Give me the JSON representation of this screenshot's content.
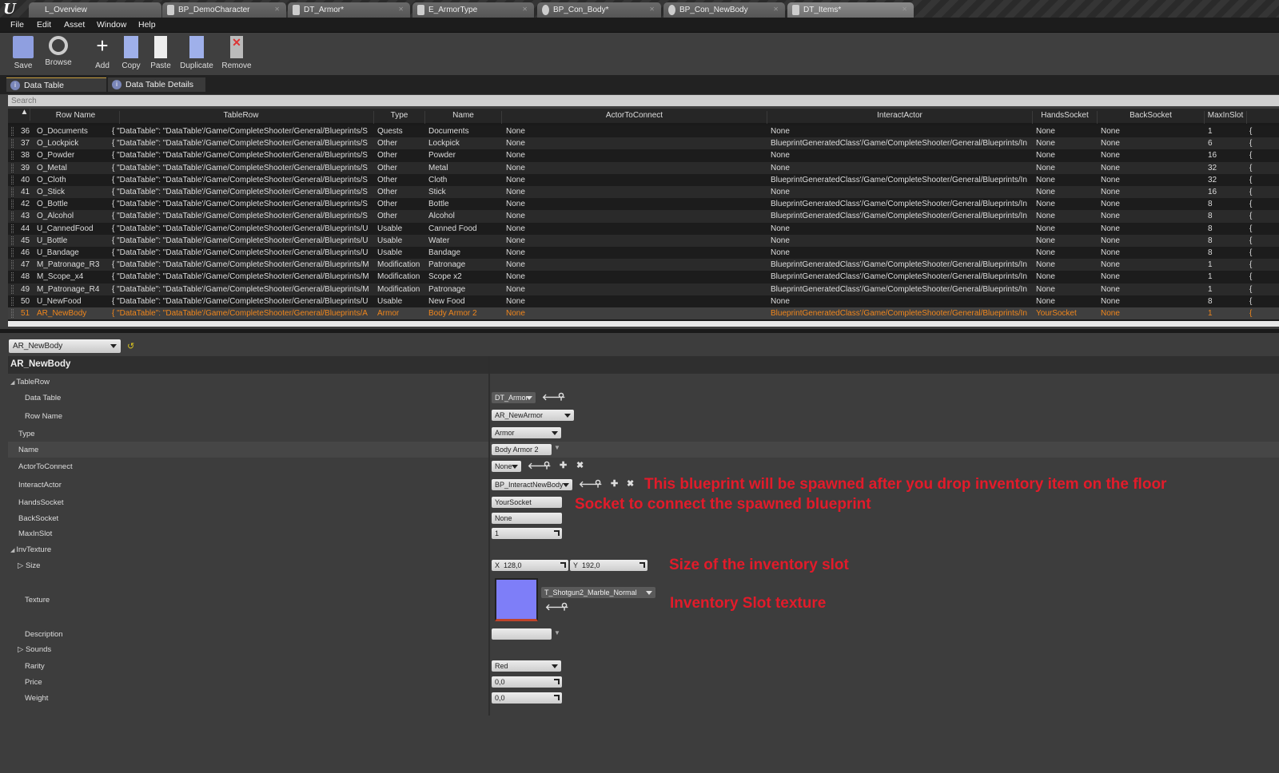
{
  "tabs": [
    {
      "label": "L_Overview",
      "active": false
    },
    {
      "label": "BP_DemoCharacter",
      "active": false
    },
    {
      "label": "DT_Armor*",
      "active": false
    },
    {
      "label": "E_ArmorType",
      "active": false
    },
    {
      "label": "BP_Con_Body*",
      "active": false
    },
    {
      "label": "BP_Con_NewBody",
      "active": false
    },
    {
      "label": "DT_Items*",
      "active": true
    }
  ],
  "menu": [
    "File",
    "Edit",
    "Asset",
    "Window",
    "Help"
  ],
  "toolbar": {
    "save": "Save",
    "browse": "Browse",
    "add": "Add",
    "copy": "Copy",
    "paste": "Paste",
    "duplicate": "Duplicate",
    "remove": "Remove"
  },
  "panel_tabs": [
    "Data Table",
    "Data Table Details"
  ],
  "search": {
    "placeholder": "Search"
  },
  "table": {
    "columns": [
      "Row Name",
      "TableRow",
      "Type",
      "Name",
      "ActorToConnect",
      "InteractActor",
      "HandsSocket",
      "BackSocket",
      "MaxInSlot"
    ],
    "rows": [
      [
        "36",
        "O_Documents",
        "{ \"DataTable\": \"DataTable'/Game/CompleteShooter/General/Blueprints/S",
        "Quests",
        "Documents",
        "None",
        "None",
        "None",
        "None",
        "1",
        "{"
      ],
      [
        "37",
        "O_Lockpick",
        "{ \"DataTable\": \"DataTable'/Game/CompleteShooter/General/Blueprints/S",
        "Other",
        "Lockpick",
        "None",
        "BlueprintGeneratedClass'/Game/CompleteShooter/General/Blueprints/In",
        "None",
        "None",
        "6",
        "{"
      ],
      [
        "38",
        "O_Powder",
        "{ \"DataTable\": \"DataTable'/Game/CompleteShooter/General/Blueprints/S",
        "Other",
        "Powder",
        "None",
        "None",
        "None",
        "None",
        "16",
        "{"
      ],
      [
        "39",
        "O_Metal",
        "{ \"DataTable\": \"DataTable'/Game/CompleteShooter/General/Blueprints/S",
        "Other",
        "Metal",
        "None",
        "None",
        "None",
        "None",
        "32",
        "{"
      ],
      [
        "40",
        "O_Cloth",
        "{ \"DataTable\": \"DataTable'/Game/CompleteShooter/General/Blueprints/S",
        "Other",
        "Cloth",
        "None",
        "BlueprintGeneratedClass'/Game/CompleteShooter/General/Blueprints/In",
        "None",
        "None",
        "32",
        "{"
      ],
      [
        "41",
        "O_Stick",
        "{ \"DataTable\": \"DataTable'/Game/CompleteShooter/General/Blueprints/S",
        "Other",
        "Stick",
        "None",
        "None",
        "None",
        "None",
        "16",
        "{"
      ],
      [
        "42",
        "O_Bottle",
        "{ \"DataTable\": \"DataTable'/Game/CompleteShooter/General/Blueprints/S",
        "Other",
        "Bottle",
        "None",
        "BlueprintGeneratedClass'/Game/CompleteShooter/General/Blueprints/In",
        "None",
        "None",
        "8",
        "{"
      ],
      [
        "43",
        "O_Alcohol",
        "{ \"DataTable\": \"DataTable'/Game/CompleteShooter/General/Blueprints/S",
        "Other",
        "Alcohol",
        "None",
        "BlueprintGeneratedClass'/Game/CompleteShooter/General/Blueprints/In",
        "None",
        "None",
        "8",
        "{"
      ],
      [
        "44",
        "U_CannedFood",
        "{ \"DataTable\": \"DataTable'/Game/CompleteShooter/General/Blueprints/U",
        "Usable",
        "Canned Food",
        "None",
        "None",
        "None",
        "None",
        "8",
        "{"
      ],
      [
        "45",
        "U_Bottle",
        "{ \"DataTable\": \"DataTable'/Game/CompleteShooter/General/Blueprints/U",
        "Usable",
        "Water",
        "None",
        "None",
        "None",
        "None",
        "8",
        "{"
      ],
      [
        "46",
        "U_Bandage",
        "{ \"DataTable\": \"DataTable'/Game/CompleteShooter/General/Blueprints/U",
        "Usable",
        "Bandage",
        "None",
        "None",
        "None",
        "None",
        "8",
        "{"
      ],
      [
        "47",
        "M_Patronage_R3",
        "{ \"DataTable\": \"DataTable'/Game/CompleteShooter/General/Blueprints/M",
        "Modification",
        "Patronage",
        "None",
        "BlueprintGeneratedClass'/Game/CompleteShooter/General/Blueprints/In",
        "None",
        "None",
        "1",
        "{"
      ],
      [
        "48",
        "M_Scope_x4",
        "{ \"DataTable\": \"DataTable'/Game/CompleteShooter/General/Blueprints/M",
        "Modification",
        "Scope x2",
        "None",
        "BlueprintGeneratedClass'/Game/CompleteShooter/General/Blueprints/In",
        "None",
        "None",
        "1",
        "{"
      ],
      [
        "49",
        "M_Patronage_R4",
        "{ \"DataTable\": \"DataTable'/Game/CompleteShooter/General/Blueprints/M",
        "Modification",
        "Patronage",
        "None",
        "BlueprintGeneratedClass'/Game/CompleteShooter/General/Blueprints/In",
        "None",
        "None",
        "1",
        "{"
      ],
      [
        "50",
        "U_NewFood",
        "{ \"DataTable\": \"DataTable'/Game/CompleteShooter/General/Blueprints/U",
        "Usable",
        "New Food",
        "None",
        "None",
        "None",
        "None",
        "8",
        "{"
      ],
      [
        "51",
        "AR_NewBody",
        "{ \"DataTable\": \"DataTable'/Game/CompleteShooter/General/Blueprints/A",
        "Armor",
        "Body Armor 2",
        "None",
        "BlueprintGeneratedClass'/Game/CompleteShooter/General/Blueprints/In",
        "YourSocket",
        "None",
        "1",
        "{"
      ]
    ],
    "selected_row": "51",
    "selected_color": "#f0861c"
  },
  "details": {
    "row_select": "AR_NewBody",
    "header": "AR_NewBody",
    "labels": {
      "tablerow": "TableRow",
      "data_table": "Data Table",
      "row_name": "Row Name",
      "type": "Type",
      "name": "Name",
      "actor_to_connect": "ActorToConnect",
      "interact_actor": "InteractActor",
      "hands_socket": "HandsSocket",
      "back_socket": "BackSocket",
      "max_in_slot": "MaxInSlot",
      "inv_texture": "InvTexture",
      "size": "Size",
      "texture": "Texture",
      "description": "Description",
      "sounds": "Sounds",
      "rarity": "Rarity",
      "price": "Price",
      "weight": "Weight"
    },
    "values": {
      "data_table": "DT_Armor",
      "row_name": "AR_NewArmor",
      "type": "Armor",
      "name": "Body Armor 2",
      "actor_to_connect": "None",
      "interact_actor": "BP_InteractNewBody",
      "hands_socket": "YourSocket",
      "back_socket": "None",
      "max_in_slot": "1",
      "size_x_label": "X",
      "size_x": "128,0",
      "size_y_label": "Y",
      "size_y": "192,0",
      "texture": "T_Shotgun2_Marble_Normal",
      "description": "",
      "rarity": "Red",
      "price": "0,0",
      "weight": "0,0"
    }
  },
  "annotations": {
    "interact_actor": "This blueprint will be spawned after you drop inventory item on the floor",
    "hands_socket": "Socket to connect the spawned blueprint",
    "size": "Size of the inventory slot",
    "texture": "Inventory Slot texture",
    "color": "#e21b2a"
  }
}
